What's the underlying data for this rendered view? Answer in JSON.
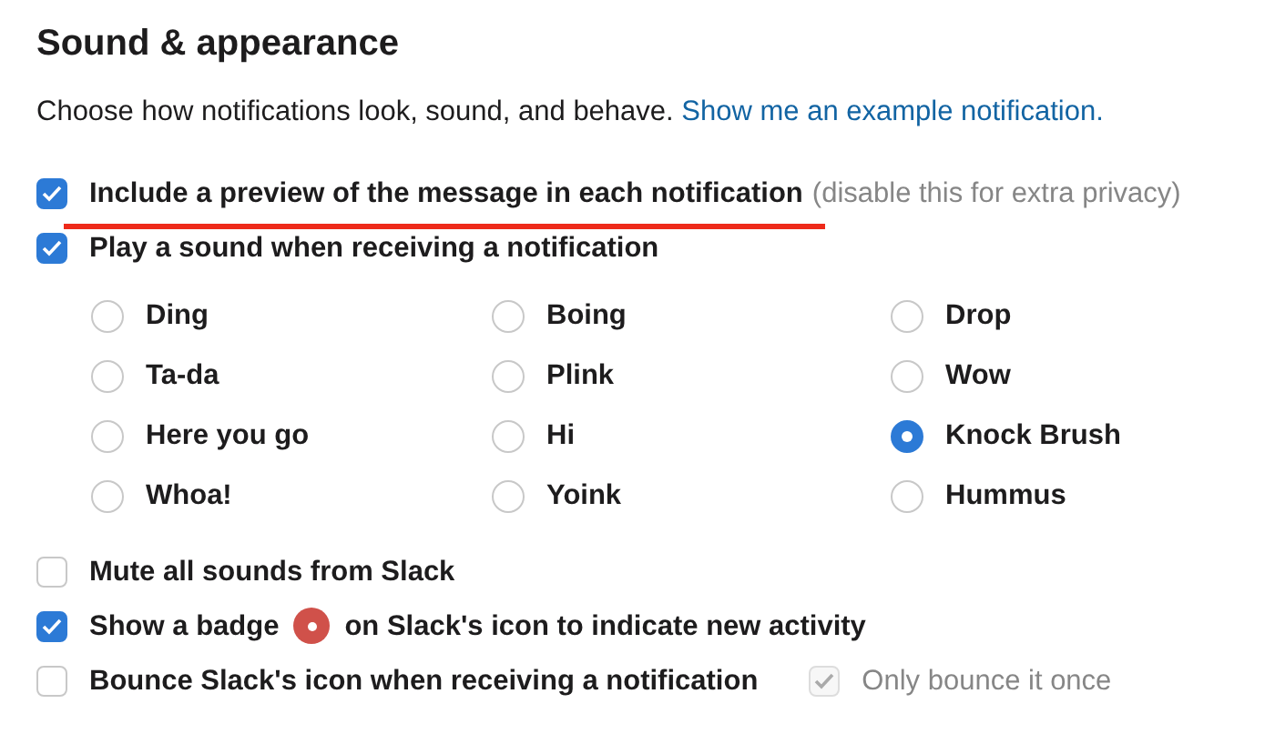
{
  "title": "Sound & appearance",
  "description": {
    "text": "Choose how notifications look, sound, and behave.",
    "link": "Show me an example notification."
  },
  "top_options": [
    {
      "label": "Include a preview of the message in each notification",
      "hint": "(disable this for extra privacy)",
      "checked": true,
      "underlined": true
    },
    {
      "label": "Play a sound when receiving a notification",
      "checked": true,
      "underlined": false
    }
  ],
  "sounds": [
    {
      "label": "Ding",
      "selected": false
    },
    {
      "label": "Boing",
      "selected": false
    },
    {
      "label": "Drop",
      "selected": false
    },
    {
      "label": "Ta-da",
      "selected": false
    },
    {
      "label": "Plink",
      "selected": false
    },
    {
      "label": "Wow",
      "selected": false
    },
    {
      "label": "Here you go",
      "selected": false
    },
    {
      "label": "Hi",
      "selected": false
    },
    {
      "label": "Knock Brush",
      "selected": true
    },
    {
      "label": "Whoa!",
      "selected": false
    },
    {
      "label": "Yoink",
      "selected": false
    },
    {
      "label": "Hummus",
      "selected": false
    }
  ],
  "bottom_options": [
    {
      "kind": "checkbox",
      "label": "Mute all sounds from Slack",
      "checked": false
    },
    {
      "kind": "badge",
      "label": "Show a badge",
      "label_after": "on Slack's icon to indicate new activity",
      "checked": true
    },
    {
      "kind": "sub",
      "label": "Bounce Slack's icon when receiving a notification",
      "checked": false,
      "sub_option": {
        "label": "Only bounce it once",
        "checked": true,
        "disabled": true
      }
    }
  ]
}
